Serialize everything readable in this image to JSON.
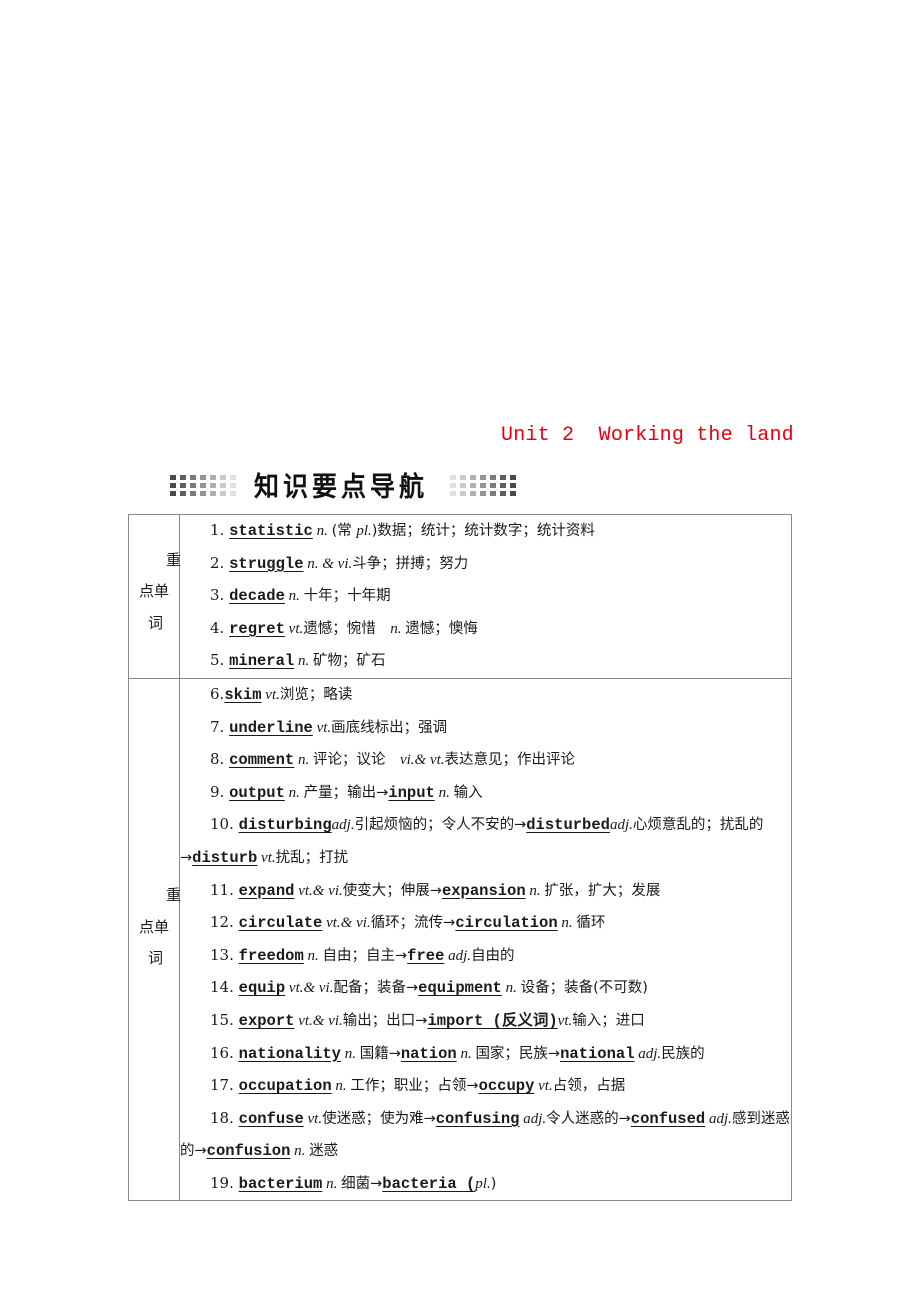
{
  "header": {
    "unit_title": "Unit 2  Working the land",
    "unit_title_color": "#e60012",
    "section_banner": "知识要点导航"
  },
  "category_label": {
    "char1": "重",
    "char2": "点单",
    "char3": "词"
  },
  "sections": [
    {
      "name": "key-words-1",
      "items": [
        {
          "num": "1.",
          "parts": [
            {
              "t": "w",
              "v": "statistic"
            },
            {
              "t": "pos",
              "v": " n. "
            },
            {
              "t": "cn",
              "v": "(常 "
            },
            {
              "t": "pos",
              "v": "pl."
            },
            {
              "t": "cn",
              "v": ")数据；统计；统计数字；统计资料"
            }
          ]
        },
        {
          "num": "2.",
          "parts": [
            {
              "t": "w",
              "v": "struggle"
            },
            {
              "t": "pos",
              "v": " n. & vi."
            },
            {
              "t": "cn",
              "v": "斗争；拼搏；努力"
            }
          ]
        },
        {
          "num": "3.",
          "parts": [
            {
              "t": "w",
              "v": "decade"
            },
            {
              "t": "pos",
              "v": " n. "
            },
            {
              "t": "cn",
              "v": "十年；十年期"
            }
          ]
        },
        {
          "num": "4.",
          "parts": [
            {
              "t": "w",
              "v": "regret"
            },
            {
              "t": "pos",
              "v": " vt."
            },
            {
              "t": "cn",
              "v": "遗憾；惋惜　"
            },
            {
              "t": "pos",
              "v": "n. "
            },
            {
              "t": "cn",
              "v": "遗憾；懊悔"
            }
          ]
        },
        {
          "num": "5.",
          "parts": [
            {
              "t": "w",
              "v": "mineral"
            },
            {
              "t": "pos",
              "v": " n. "
            },
            {
              "t": "cn",
              "v": "矿物；矿石"
            }
          ]
        }
      ]
    },
    {
      "name": "key-words-2",
      "items": [
        {
          "num": "6.",
          "parts": [
            {
              "t": "w",
              "v": "skim"
            },
            {
              "t": "pos",
              "v": "  vt."
            },
            {
              "t": "cn",
              "v": "浏览；略读"
            }
          ]
        },
        {
          "num": "7.",
          "parts": [
            {
              "t": "w",
              "v": "underline"
            },
            {
              "t": "pos",
              "v": "  vt."
            },
            {
              "t": "cn",
              "v": "画底线标出；强调"
            }
          ]
        },
        {
          "num": "8.",
          "parts": [
            {
              "t": "w",
              "v": "comment"
            },
            {
              "t": "pos",
              "v": " n. "
            },
            {
              "t": "cn",
              "v": "评论；议论　"
            },
            {
              "t": "pos",
              "v": "vi.& vt."
            },
            {
              "t": "cn",
              "v": "表达意见；作出评论"
            }
          ]
        },
        {
          "num": "9.",
          "parts": [
            {
              "t": "w",
              "v": "output"
            },
            {
              "t": "pos",
              "v": " n. "
            },
            {
              "t": "cn",
              "v": "产量；输出→"
            },
            {
              "t": "w",
              "v": "input"
            },
            {
              "t": "pos",
              "v": " n. "
            },
            {
              "t": "cn",
              "v": "输入"
            }
          ]
        },
        {
          "num": "10.",
          "wrap": true,
          "parts": [
            {
              "t": "w",
              "v": "disturbing"
            },
            {
              "t": "pos",
              "v": "adj."
            },
            {
              "t": "cn",
              "v": "引起烦恼的；令人不安的→"
            },
            {
              "t": "w",
              "v": "disturbed"
            },
            {
              "t": "pos",
              "v": "adj."
            },
            {
              "t": "cn",
              "v": "心烦意乱的；扰乱的→"
            },
            {
              "t": "w",
              "v": "disturb"
            },
            {
              "t": "pos",
              "v": "  vt."
            },
            {
              "t": "cn",
              "v": "扰乱；打扰"
            }
          ]
        },
        {
          "num": "11.",
          "parts": [
            {
              "t": "w",
              "v": "expand"
            },
            {
              "t": "pos",
              "v": "  vt.& vi."
            },
            {
              "t": "cn",
              "v": "使变大；伸展→"
            },
            {
              "t": "w",
              "v": "expansion"
            },
            {
              "t": "pos",
              "v": " n. "
            },
            {
              "t": "cn",
              "v": "扩张，扩大；发展"
            }
          ]
        },
        {
          "num": "12.",
          "parts": [
            {
              "t": "w",
              "v": "circulate"
            },
            {
              "t": "pos",
              "v": "  vt.& vi."
            },
            {
              "t": "cn",
              "v": "循环；流传→"
            },
            {
              "t": "w",
              "v": "circulation"
            },
            {
              "t": "pos",
              "v": " n. "
            },
            {
              "t": "cn",
              "v": "循环"
            }
          ]
        },
        {
          "num": "13.",
          "parts": [
            {
              "t": "w",
              "v": "freedom"
            },
            {
              "t": "pos",
              "v": " n. "
            },
            {
              "t": "cn",
              "v": "自由；自主→"
            },
            {
              "t": "w",
              "v": "free"
            },
            {
              "t": "pos",
              "v": " adj."
            },
            {
              "t": "cn",
              "v": "自由的"
            }
          ]
        },
        {
          "num": "14.",
          "parts": [
            {
              "t": "w",
              "v": "equip"
            },
            {
              "t": "pos",
              "v": "  vt.& vi."
            },
            {
              "t": "cn",
              "v": "配备；装备→"
            },
            {
              "t": "w",
              "v": "equipment"
            },
            {
              "t": "pos",
              "v": " n. "
            },
            {
              "t": "cn",
              "v": "设备；装备(不可数)"
            }
          ]
        },
        {
          "num": "15.",
          "parts": [
            {
              "t": "w",
              "v": "export"
            },
            {
              "t": "pos",
              "v": "  vt.& vi."
            },
            {
              "t": "cn",
              "v": "输出；出口→"
            },
            {
              "t": "w",
              "v": "import (反义词)"
            },
            {
              "t": "pos",
              "v": "vt."
            },
            {
              "t": "cn",
              "v": "输入；进口"
            }
          ]
        },
        {
          "num": "16.",
          "parts": [
            {
              "t": "w",
              "v": "nationality"
            },
            {
              "t": "pos",
              "v": " n. "
            },
            {
              "t": "cn",
              "v": "国籍→"
            },
            {
              "t": "w",
              "v": "nation"
            },
            {
              "t": "pos",
              "v": " n. "
            },
            {
              "t": "cn",
              "v": "国家；民族→"
            },
            {
              "t": "w",
              "v": "national"
            },
            {
              "t": "pos",
              "v": " adj."
            },
            {
              "t": "cn",
              "v": "民族的"
            }
          ]
        },
        {
          "num": "17.",
          "parts": [
            {
              "t": "w",
              "v": "occupation"
            },
            {
              "t": "pos",
              "v": " n. "
            },
            {
              "t": "cn",
              "v": "工作；职业；占领→"
            },
            {
              "t": "w",
              "v": "occupy"
            },
            {
              "t": "pos",
              "v": "  vt."
            },
            {
              "t": "cn",
              "v": "占领，占据"
            }
          ]
        },
        {
          "num": "18.",
          "wrap": true,
          "parts": [
            {
              "t": "w",
              "v": "confuse"
            },
            {
              "t": "pos",
              "v": "  vt."
            },
            {
              "t": "cn",
              "v": "使迷惑；使为难→"
            },
            {
              "t": "w",
              "v": "confusing"
            },
            {
              "t": "pos",
              "v": "  adj."
            },
            {
              "t": "cn",
              "v": "令人迷惑的→"
            },
            {
              "t": "w",
              "v": "confused"
            },
            {
              "t": "pos",
              "v": "  adj."
            },
            {
              "t": "cn",
              "v": "感到迷惑的→"
            },
            {
              "t": "w",
              "v": "confusion"
            },
            {
              "t": "pos",
              "v": " n. "
            },
            {
              "t": "cn",
              "v": "迷惑"
            }
          ]
        },
        {
          "num": "19.",
          "parts": [
            {
              "t": "w",
              "v": "bacterium"
            },
            {
              "t": "pos",
              "v": " n. "
            },
            {
              "t": "cn",
              "v": "细菌→"
            },
            {
              "t": "w",
              "v": "bacteria ("
            },
            {
              "t": "pos",
              "v": "pl."
            },
            {
              "t": "cn",
              "v": ")"
            }
          ]
        }
      ]
    }
  ]
}
